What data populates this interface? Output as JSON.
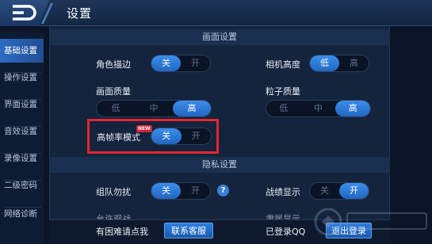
{
  "header": {
    "title": "设置"
  },
  "sidebar": {
    "items": [
      {
        "label": "基础设置",
        "active": true
      },
      {
        "label": "操作设置",
        "active": false
      },
      {
        "label": "界面设置",
        "active": false
      },
      {
        "label": "音效设置",
        "active": false
      },
      {
        "label": "录像设置",
        "active": false
      },
      {
        "label": "二级密码",
        "active": false
      },
      {
        "label": "网络诊断",
        "active": false
      }
    ]
  },
  "sections": {
    "graphics": "画面设置",
    "privacy": "隐私设置"
  },
  "settings": {
    "outline": {
      "label": "角色描边",
      "options": [
        "关",
        "开"
      ],
      "selected": "关"
    },
    "camera": {
      "label": "相机高度",
      "options": [
        "低",
        "高"
      ],
      "selected": "低"
    },
    "quality": {
      "label": "画面质量",
      "options": [
        "低",
        "中",
        "高"
      ],
      "selected": "高"
    },
    "particle": {
      "label": "粒子质量",
      "options": [
        "低",
        "中",
        "高"
      ],
      "selected": "高"
    },
    "hfr": {
      "label": "高帧率模式",
      "badge": "NEW",
      "options": [
        "关",
        "开"
      ],
      "selected": "关"
    },
    "team": {
      "label": "组队勿扰",
      "options": [
        "关",
        "开"
      ],
      "selected": "关",
      "help": "?"
    },
    "record": {
      "label": "战绩显示",
      "options": [
        "关",
        "开"
      ],
      "selected": "开"
    },
    "partial1": {
      "label": "允许观战"
    },
    "partial2": {
      "label": "隶属显示"
    }
  },
  "footer": {
    "help_text": "有困难请点我",
    "contact_button": "联系客服",
    "login_status": "已登录QQ",
    "logout_button": "退出登录"
  },
  "colors": {
    "accent": "#2e7fe0",
    "highlight": "#e3262e",
    "background": "#0b1526"
  }
}
